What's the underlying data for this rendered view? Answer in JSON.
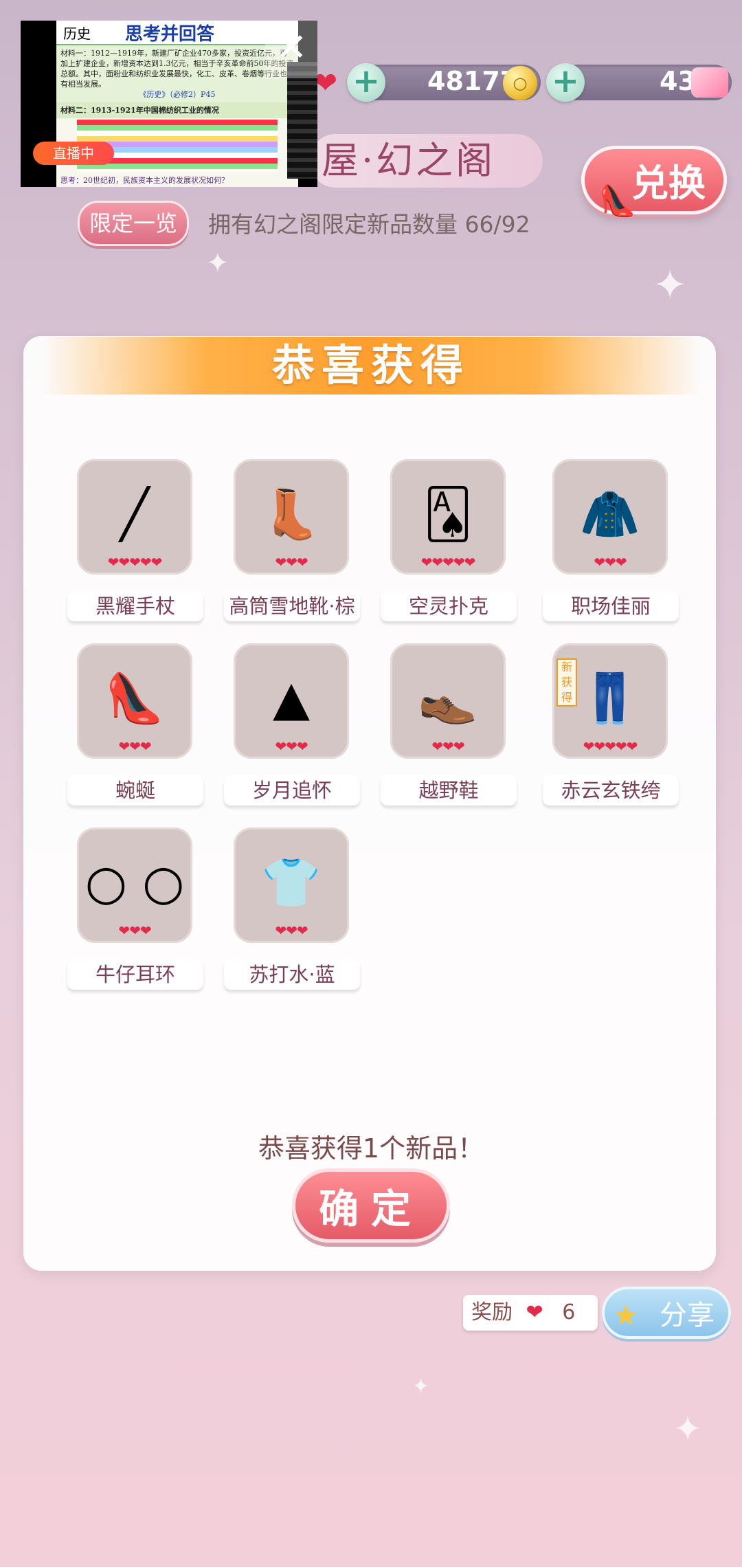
{
  "top_bar": {
    "coins": "48177",
    "gems": "43",
    "coin_symbol": "○",
    "plus": "+",
    "heart": "❤"
  },
  "video": {
    "doc_left": "历史",
    "doc_title": "思考并回答",
    "material1": "材料一：1912—1919年，新建厂矿企业470多家，投资近亿元，再加上扩建企业，新增资本达到1.3亿元，相当于辛亥革命前50年的投资总额。其中，面粉业和纺织业发展最快，化工、皮革、卷烟等行业也有相当发展。",
    "material1_src": "《历史》（必修2）P45",
    "material2": "材料二：1913-1921年中国棉纺织工业的情况",
    "question": "思考：20世纪初，民族资本主义的发展状况如何？",
    "live_badge": "直播中",
    "close": "✕"
  },
  "header": {
    "title": "屋·幻之阁",
    "exchange_label": "兑换",
    "limited_label": "限定一览",
    "owned_text": "拥有幻之阁限定新品数量 66/92"
  },
  "panel": {
    "ribbon": "恭喜获得",
    "items": [
      {
        "name": "黑耀手杖",
        "hearts": "❤❤❤❤❤",
        "icon": "cane-icon",
        "glyph": "╱"
      },
      {
        "name": "高筒雪地靴·棕",
        "hearts": "❤❤❤",
        "icon": "boots-icon",
        "glyph": "👢"
      },
      {
        "name": "空灵扑克",
        "hearts": "❤❤❤❤❤",
        "icon": "cards-icon",
        "glyph": "🂡"
      },
      {
        "name": "职场佳丽",
        "hearts": "❤❤❤",
        "icon": "jacket-icon",
        "glyph": "🧥"
      },
      {
        "name": "蜿蜒",
        "hearts": "❤❤❤",
        "icon": "heels-icon",
        "glyph": "👠"
      },
      {
        "name": "岁月追怀",
        "hearts": "❤❤❤",
        "icon": "skirt-icon",
        "glyph": "▲"
      },
      {
        "name": "越野鞋",
        "hearts": "❤❤❤",
        "icon": "shoes-icon",
        "glyph": "👞"
      },
      {
        "name": "赤云玄铁绔",
        "hearts": "❤❤❤❤❤",
        "icon": "pants-icon",
        "glyph": "👖",
        "new_tag": "新获得"
      },
      {
        "name": "牛仔耳环",
        "hearts": "❤❤❤",
        "icon": "earrings-icon",
        "glyph": "○ ○"
      },
      {
        "name": "苏打水·蓝",
        "hearts": "❤❤❤",
        "icon": "shirt-icon",
        "glyph": "👕"
      }
    ],
    "congrats_text": "恭喜获得1个新品！",
    "confirm_label": "确定"
  },
  "footer": {
    "reward_label": "奖励",
    "reward_heart": "❤",
    "reward_count": "6",
    "share_label": "分享"
  }
}
